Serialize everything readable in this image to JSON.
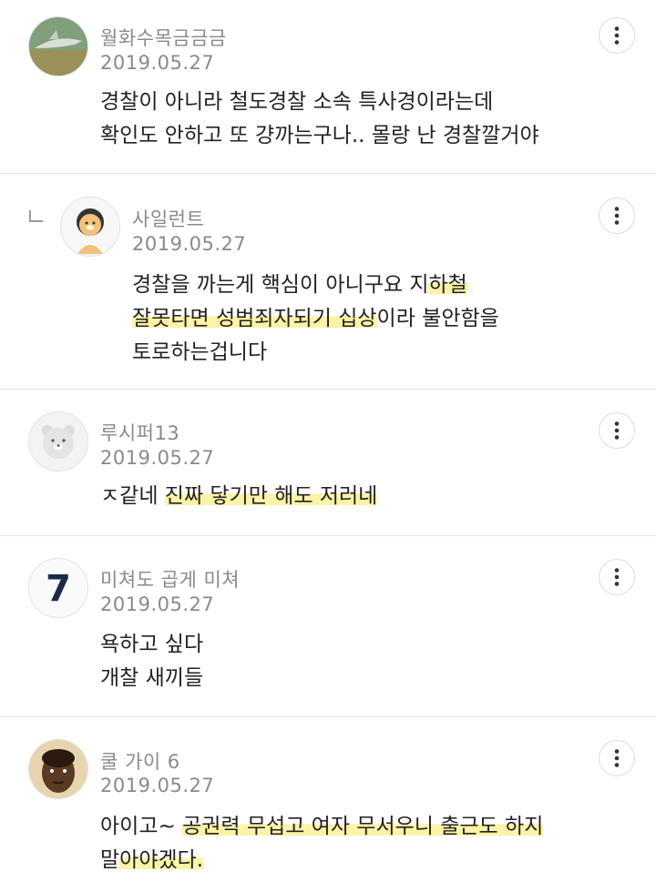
{
  "comments": [
    {
      "nickname": "월화수목금금금",
      "date": "2019.05.27",
      "lines": [
        "경찰이 아니라 철도경찰 소속 특사경이라는데",
        "확인도 안하고 또 걍까는구나.. 몰랑 난 경찰깔거야"
      ],
      "avatar_icon": "shark-icon"
    },
    {
      "nickname": "사일런트",
      "date": "2019.05.27",
      "is_reply": true,
      "line1_plain": "경찰을 까는게 핵심이 아니구요 지",
      "line1_hl": "하철",
      "line2_hl": "잘못타면 성범죄자되기 십상",
      "line2_plain": "이라 불안함을",
      "line3": "토로하는겁니다",
      "avatar_icon": "ryan-character-icon"
    },
    {
      "nickname": "루시퍼13",
      "date": "2019.05.27",
      "line1_plain": "ㅈ같네 ",
      "line1_hl": "진짜 닿기만 해도 저러네",
      "avatar_icon": "bear-character-icon"
    },
    {
      "nickname": "미쳐도 곱게 미쳐",
      "date": "2019.05.27",
      "lines": [
        "욕하고 싶다",
        "개찰 새끼들"
      ],
      "avatar_icon": "number-seven-icon"
    },
    {
      "nickname": "쿨 가이 6",
      "date": "2019.05.27",
      "line1_plain": "아이고~ ",
      "line1_hl": "공권력 무섭고 여자 무서우니 출근도 하지",
      "line2_plain": "말",
      "line2_hl": "아야겠다.",
      "avatar_icon": "person-face-icon"
    }
  ],
  "colors": {
    "highlight": "#fbf3a6",
    "meta_text": "#8a8a8a",
    "body_text": "#222222",
    "divider": "#e6e6e6"
  }
}
